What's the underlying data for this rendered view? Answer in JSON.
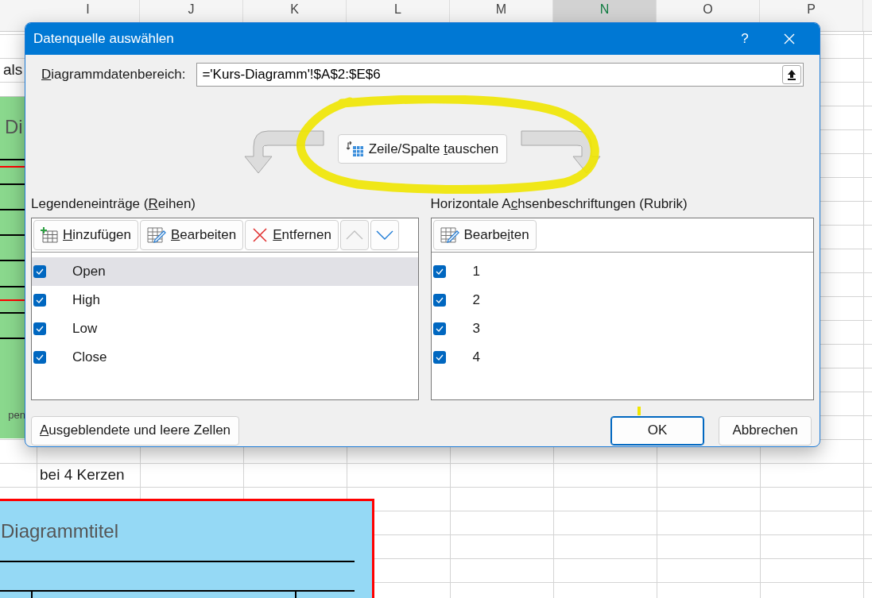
{
  "sheet": {
    "column_headers": [
      {
        "label": "I",
        "selected": false
      },
      {
        "label": "J",
        "selected": false
      },
      {
        "label": "K",
        "selected": false
      },
      {
        "label": "L",
        "selected": false
      },
      {
        "label": "M",
        "selected": false
      },
      {
        "label": "N",
        "selected": true
      },
      {
        "label": "O",
        "selected": false
      },
      {
        "label": "P",
        "selected": false
      }
    ],
    "cells": [
      {
        "text": "als"
      },
      {
        "text": "bei 4 Kerzen"
      }
    ],
    "charts": [
      {
        "title": "Di",
        "legend": "pen"
      },
      {
        "title": "Diagrammtitel"
      }
    ]
  },
  "dialog": {
    "title": "Datenquelle auswählen",
    "help_button": "?",
    "range": {
      "label": {
        "key": "D",
        "post": "iagrammdatenbereich:"
      },
      "value": "='Kurs-Diagramm'!$A$2:$E$6"
    },
    "switch_button": {
      "pre": "Zeile/Spalte ",
      "key": "t",
      "post": "auschen"
    },
    "series": {
      "heading": {
        "pre": "Legendeneinträge (",
        "key": "R",
        "post": "eihen)"
      },
      "toolbar": [
        {
          "kind": "add",
          "label": {
            "key": "H",
            "post": "inzufügen"
          },
          "disabled": false
        },
        {
          "kind": "edit",
          "label": {
            "key": "B",
            "post": "earbeiten"
          },
          "disabled": false
        },
        {
          "kind": "remove",
          "label": {
            "key": "E",
            "post": "ntfernen"
          },
          "disabled": false
        },
        {
          "kind": "up",
          "disabled": true
        },
        {
          "kind": "down",
          "disabled": false
        }
      ],
      "items": [
        {
          "label": "Open",
          "checked": true,
          "selected": true
        },
        {
          "label": "High",
          "checked": true,
          "selected": false
        },
        {
          "label": "Low",
          "checked": true,
          "selected": false
        },
        {
          "label": "Close",
          "checked": true,
          "selected": false
        }
      ]
    },
    "categories": {
      "heading": {
        "pre": "Horizontale A",
        "key": "c",
        "post": "hsenbeschriftungen (Rubrik)"
      },
      "toolbar": [
        {
          "kind": "edit",
          "label": {
            "pre": "Bearbe",
            "key": "i",
            "post": "ten"
          },
          "disabled": false
        }
      ],
      "items": [
        {
          "label": "1",
          "checked": true,
          "selected": false
        },
        {
          "label": "2",
          "checked": true,
          "selected": false
        },
        {
          "label": "3",
          "checked": true,
          "selected": false
        },
        {
          "label": "4",
          "checked": true,
          "selected": false
        }
      ]
    },
    "hidden_cells_button": {
      "key": "A",
      "post": "usgeblendete und leere Zellen"
    },
    "ok_button": {
      "pre": "OK"
    },
    "cancel_button": {
      "pre": "Abbrechen"
    }
  }
}
